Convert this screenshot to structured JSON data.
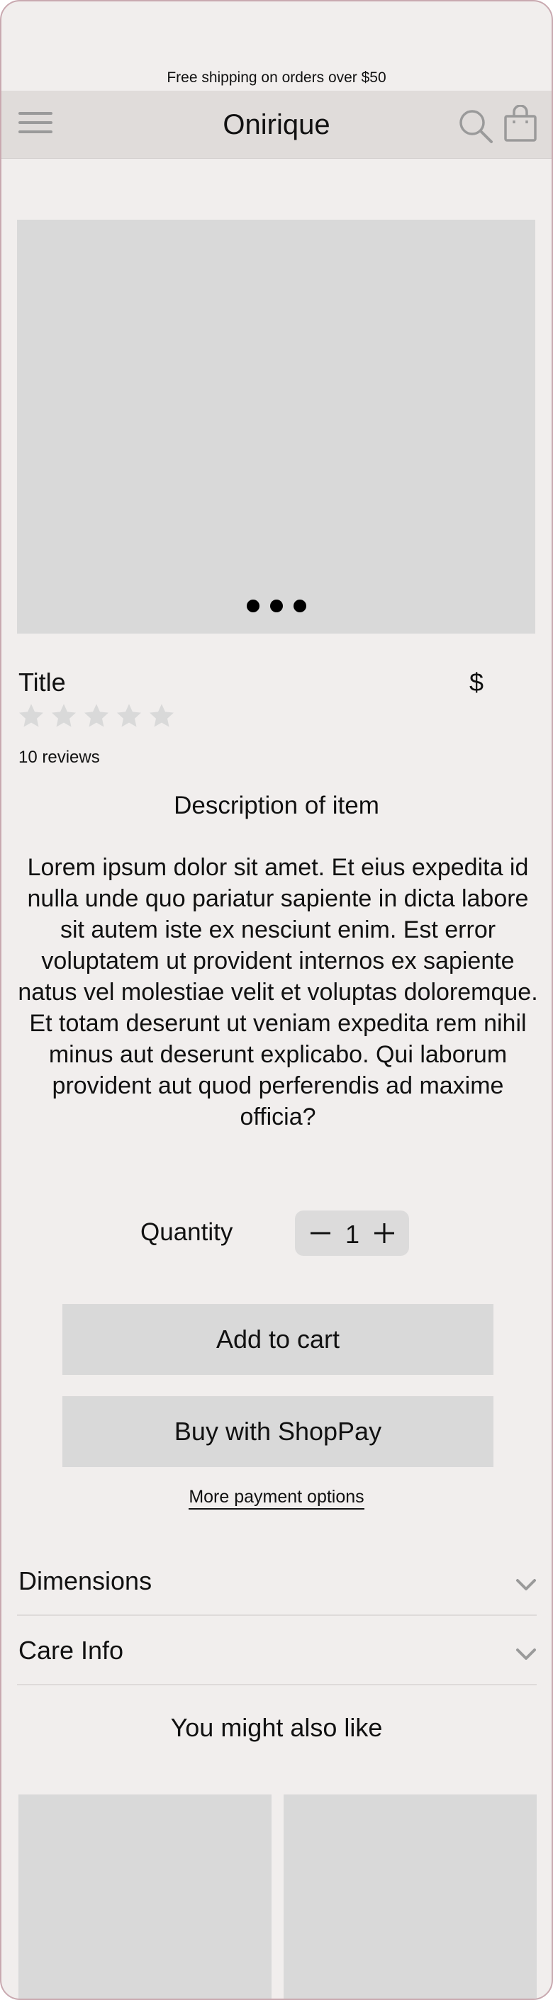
{
  "announcement": "Free shipping on orders over $50",
  "header": {
    "brand": "Onirique",
    "icons": {
      "menu": "hamburger-menu-icon",
      "search": "search-icon",
      "cart": "shopping-bag-icon"
    }
  },
  "carousel": {
    "slide_count": 3,
    "active_index": 0
  },
  "product": {
    "title": "Title",
    "price": "$",
    "rating": {
      "max": 5,
      "value": 0
    },
    "reviews": "10 reviews",
    "description_title": "Description of item",
    "description": "Lorem ipsum dolor sit amet. Et eius expedita id nulla unde quo pariatur sapiente in dicta labore sit autem iste ex nesciunt enim. Est error voluptatem ut provident internos ex sapiente natus vel molestiae velit et voluptas doloremque. Et totam deserunt ut veniam expedita rem nihil minus aut deserunt explicabo. Qui laborum provident aut quod perferendis ad maxime officia?"
  },
  "quantity": {
    "label": "Quantity",
    "value": "1"
  },
  "actions": {
    "add_to_cart": "Add to cart",
    "buy_with_shoppay": "Buy with ShopPay",
    "more_payment_options": "More payment options"
  },
  "accordions": [
    {
      "label": "Dimensions"
    },
    {
      "label": "Care Info"
    }
  ],
  "recommendations": {
    "title": "You might also like"
  },
  "colors": {
    "background": "#f1eeed",
    "header_bg": "#e0dcda",
    "placeholder": "#d9d9d9",
    "icon_gray": "#9a9a9a",
    "frame_border": "#c9a9b0"
  }
}
